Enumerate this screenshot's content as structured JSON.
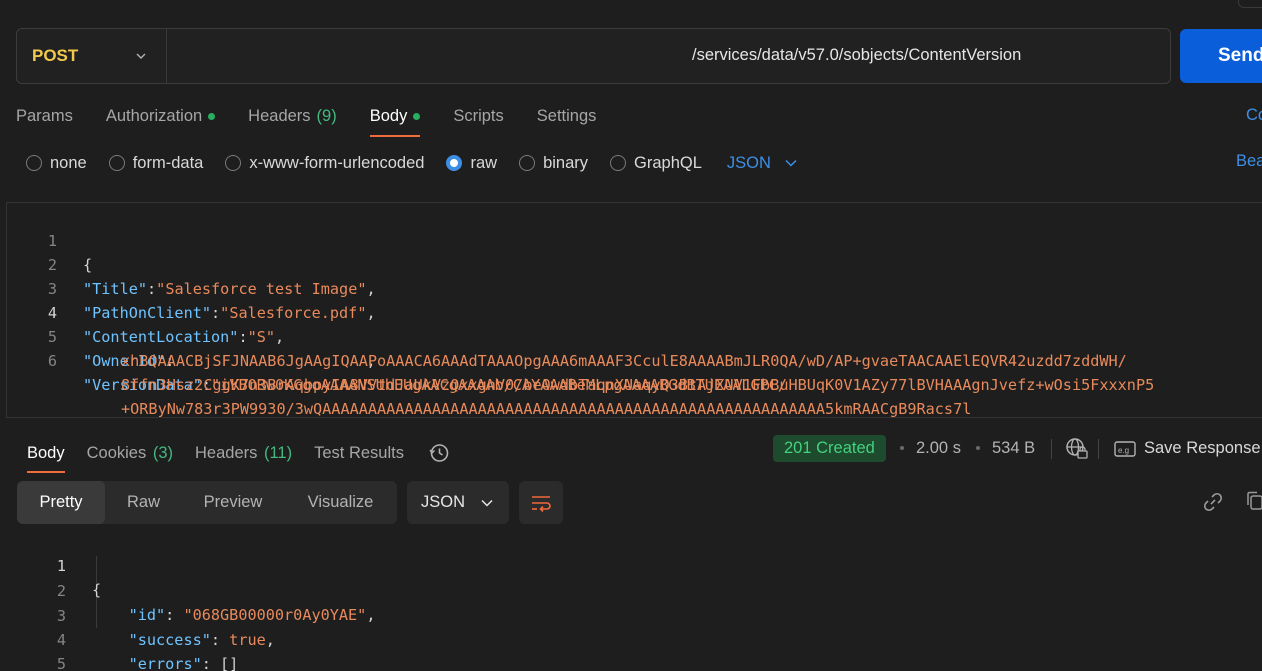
{
  "request": {
    "method": "POST",
    "url": "/services/data/v57.0/sobjects/ContentVersion",
    "send_label": "Send"
  },
  "request_tabs": [
    {
      "label": "Params",
      "dot": false,
      "count": ""
    },
    {
      "label": "Authorization",
      "dot": true,
      "count": ""
    },
    {
      "label": "Headers",
      "dot": false,
      "count": "(9)"
    },
    {
      "label": "Body",
      "dot": true,
      "count": "",
      "active": true
    },
    {
      "label": "Scripts",
      "dot": false,
      "count": ""
    },
    {
      "label": "Settings",
      "dot": false,
      "count": ""
    }
  ],
  "request_tabs_right": "Co",
  "body_types": {
    "none": "none",
    "form_data": "form-data",
    "urlencoded": "x-www-form-urlencoded",
    "raw": "raw",
    "binary": "binary",
    "graphql": "GraphQL",
    "selected": "raw",
    "language": "JSON",
    "right_link": "Bea"
  },
  "request_body": {
    "line_numbers": [
      "1",
      "2",
      "3",
      "4",
      "5",
      "6"
    ],
    "open_brace": "{",
    "title_key": "\"Title\"",
    "title_val": "\"Salesforce test Image\"",
    "path_key": "\"PathOnClient\"",
    "path_val": "\"Salesforce.pdf\"",
    "location_key": "\"ContentLocation\"",
    "location_val": "\"S\"",
    "owner_key": "\"OwnerId\"",
    "version_key": "\"VersionData\"",
    "version_val_1": "\"iVBORw0KGgoAAAANSUhEUgAACgAAAAb/CAYAAABeMLpgAAAABGdBTUEAALGPC/",
    "version_val_2": "xhBQAAACBjSFJNAAB6JgAAgIQAAPoAAACA6AAAdTAAAOpgAAA6mAAAF3CculE8AAAABmJLR0QA/wD/AP+gvaeTAACAAElEQVR42uzdd7zddWH/",
    "version_val_3": "8ffn3Hsz2CggK7n3BrAqbpyIA8VVtdJaUkVzQxxgnV0/be0wdbTaqnXUaqyQ3BtAjXUV1FbBuHBUqK0V1AZy77lBVHAAAgnJvefz+wOsi5FxxxnP5",
    "version_val_4": "+ORByNw783r3PW9930/3wQAAAAAAAAAAAAAAAAAAAAAAAAAAAAAAAAAAAAAAAAAAAAAAAAAAAAAAA5kmRAACgB9Racs7l"
  },
  "response_tabs": [
    {
      "label": "Body",
      "count": "",
      "active": true
    },
    {
      "label": "Cookies",
      "count": "(3)"
    },
    {
      "label": "Headers",
      "count": "(11)"
    },
    {
      "label": "Test Results",
      "count": ""
    }
  ],
  "response_meta": {
    "status": "201 Created",
    "time": "2.00 s",
    "size": "534 B",
    "save_label": "Save Response"
  },
  "response_view": {
    "modes": [
      "Pretty",
      "Raw",
      "Preview",
      "Visualize"
    ],
    "active": "Pretty",
    "format": "JSON"
  },
  "response_body": {
    "line_numbers": [
      "1",
      "2",
      "3",
      "4",
      "5"
    ],
    "open_brace": "{",
    "close_brace": "}",
    "id_key": "\"id\"",
    "id_val": "\"068GB00000r0Ay0YAE\"",
    "success_key": "\"success\"",
    "success_val": "true",
    "errors_key": "\"errors\"",
    "errors_val": "[]"
  },
  "colors": {
    "accent_blue": "#0a5ed9",
    "method_yellow": "#f2c94c",
    "tab_underline": "#f26b3a",
    "status_green": "#43d27f"
  }
}
